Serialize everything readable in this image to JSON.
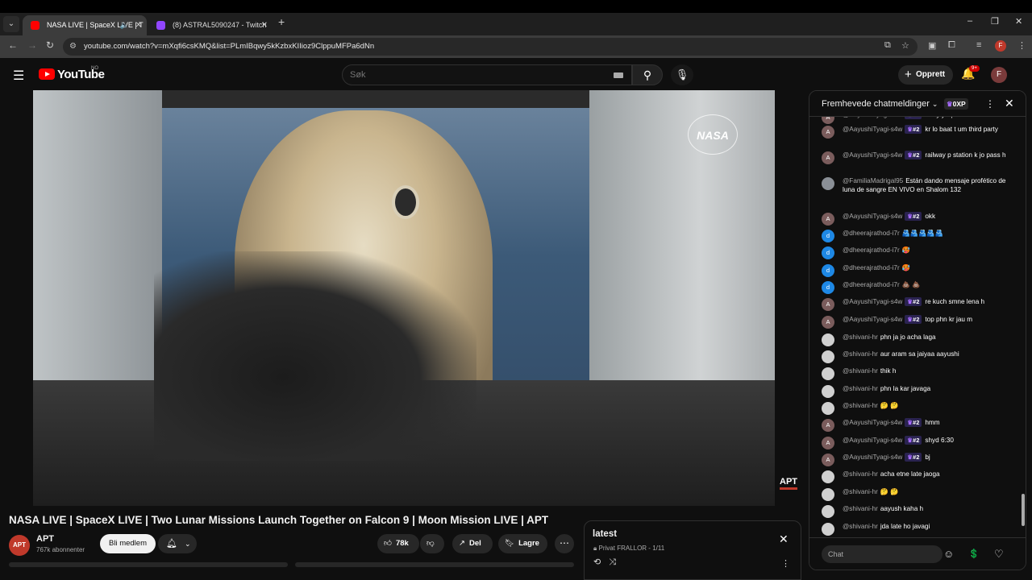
{
  "browser": {
    "tabs": [
      {
        "title": "NASA LIVE | SpaceX LIVE | T"
      },
      {
        "title": "(8) ASTRAL5090247 - Twitch"
      }
    ],
    "url": "youtube.com/watch?v=mXqfi6csKMQ&list=PLmIBqwy5kKzbxKIIioz9ClppuMFPa6dNn",
    "profile_letter": "F"
  },
  "youtube": {
    "brand": "YouTube",
    "country_code": "NO",
    "search_placeholder": "Søk",
    "create_label": "Opprett",
    "notif_badge": "9+",
    "avatar_letter": "F"
  },
  "video": {
    "title": "NASA LIVE | SpaceX LIVE | Two Lunar Missions Launch Together on Falcon 9 | Moon Mission LIVE | APT",
    "overlay_logo": "NASA",
    "watermark": "APT"
  },
  "channel": {
    "avatar_text": "APT",
    "name": "APT",
    "subs": "767k abonnenter",
    "member_label": "Bli medlem"
  },
  "actions": {
    "likes": "78k",
    "share": "Del",
    "save": "Lagre"
  },
  "playlist": {
    "title": "latest",
    "privacy": "Privat",
    "owner_pos": "FRALLOR - 1/11"
  },
  "chat": {
    "header": "Fremhevede chatmeldinger",
    "xp": "0XP",
    "input_placeholder": "Chat",
    "badge_text": "#2",
    "messages": [
      {
        "author": "@AayushiTyagi-s4w",
        "badge": true,
        "text": "sorry yrr plc",
        "avatar": "A",
        "color": "#7a5c5c"
      },
      {
        "author": "@AayushiTyagi-s4w",
        "badge": true,
        "text": "kr lo baat t um third party",
        "avatar": "A",
        "color": "#7a5c5c"
      },
      {
        "author": "@AayushiTyagi-s4w",
        "badge": true,
        "text": "railway p station k jo pass h",
        "avatar": "A",
        "color": "#7a5c5c"
      },
      {
        "author": "@FamiliaMadrigal95",
        "badge": false,
        "text": "Están dando mensaje profético de luna de sangre EN VIVO en Shalom 132",
        "avatar": "",
        "color": "#8a8f96"
      },
      {
        "author": "@AayushiTyagi-s4w",
        "badge": true,
        "text": "okk",
        "avatar": "A",
        "color": "#7a5c5c"
      },
      {
        "author": "@dheerajrathod-i7r",
        "badge": false,
        "text": "🫂🫂🫂🫂🫂",
        "avatar": "d",
        "color": "#1e88e5"
      },
      {
        "author": "@dheerajrathod-i7r",
        "badge": false,
        "text": "🥵",
        "avatar": "d",
        "color": "#1e88e5"
      },
      {
        "author": "@dheerajrathod-i7r",
        "badge": false,
        "text": "🥵",
        "avatar": "d",
        "color": "#1e88e5"
      },
      {
        "author": "@dheerajrathod-i7r",
        "badge": false,
        "text": "💩 💩",
        "avatar": "d",
        "color": "#1e88e5"
      },
      {
        "author": "@AayushiTyagi-s4w",
        "badge": true,
        "text": "re kuch smne lena h",
        "avatar": "A",
        "color": "#7a5c5c"
      },
      {
        "author": "@AayushiTyagi-s4w",
        "badge": true,
        "text": "top phn kr jau m",
        "avatar": "A",
        "color": "#7a5c5c"
      },
      {
        "author": "@shivani-hr",
        "badge": false,
        "text": "phn ja jo acha laga",
        "avatar": "",
        "color": "#d0d0d0"
      },
      {
        "author": "@shivani-hr",
        "badge": false,
        "text": "aur aram sa jaiyaa aayushi",
        "avatar": "",
        "color": "#d0d0d0"
      },
      {
        "author": "@shivani-hr",
        "badge": false,
        "text": "thik h",
        "avatar": "",
        "color": "#d0d0d0"
      },
      {
        "author": "@shivani-hr",
        "badge": false,
        "text": "phn la kar javaga",
        "avatar": "",
        "color": "#d0d0d0"
      },
      {
        "author": "@shivani-hr",
        "badge": false,
        "text": "🤔 🤔",
        "avatar": "",
        "color": "#d0d0d0"
      },
      {
        "author": "@AayushiTyagi-s4w",
        "badge": true,
        "text": "hmm",
        "avatar": "A",
        "color": "#7a5c5c"
      },
      {
        "author": "@AayushiTyagi-s4w",
        "badge": true,
        "text": "shyd 6:30",
        "avatar": "A",
        "color": "#7a5c5c"
      },
      {
        "author": "@AayushiTyagi-s4w",
        "badge": true,
        "text": "bj",
        "avatar": "A",
        "color": "#7a5c5c"
      },
      {
        "author": "@shivani-hr",
        "badge": false,
        "text": "acha etne late jaoga",
        "avatar": "",
        "color": "#d0d0d0"
      },
      {
        "author": "@shivani-hr",
        "badge": false,
        "text": "🤔 🤔",
        "avatar": "",
        "color": "#d0d0d0"
      },
      {
        "author": "@shivani-hr",
        "badge": false,
        "text": "aayush kaha h",
        "avatar": "",
        "color": "#d0d0d0"
      },
      {
        "author": "@shivani-hr",
        "badge": false,
        "text": "jda late ho javagi",
        "avatar": "",
        "color": "#d0d0d0"
      }
    ]
  },
  "colors": {
    "yt_red": "#ff0000",
    "channel_red": "#c0392b",
    "badge_purple": "#a66bff"
  }
}
